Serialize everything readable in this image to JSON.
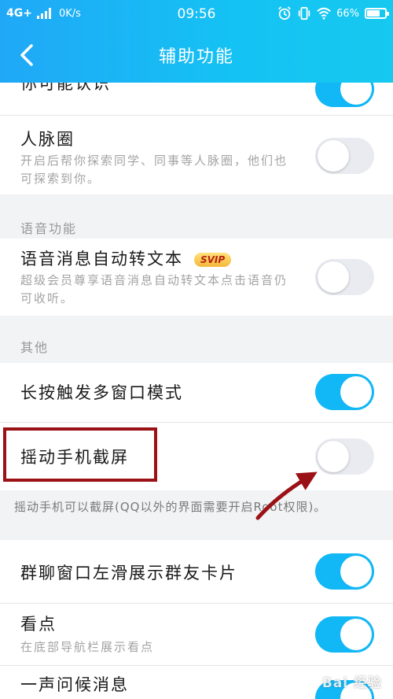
{
  "status_bar": {
    "network": "4G+",
    "speed": "0K/s",
    "time": "09:56",
    "battery": "66%"
  },
  "header": {
    "title": "辅助功能",
    "back_icon": "chevron-left-icon"
  },
  "colors": {
    "header_gradient_start": "#20a8f7",
    "header_gradient_end": "#16c9f0",
    "toggle_on": "#12b7f5",
    "toggle_off": "#e9ebf0",
    "highlight_box": "#9a1116",
    "arrow": "#9a1116"
  },
  "rows": {
    "may_know": {
      "title": "你可能认识",
      "enabled": true
    },
    "contacts_circle": {
      "title": "人脉圈",
      "desc": "开启后帮你探索同学、同事等人脉圈，他们也可探索到你。",
      "enabled": false
    },
    "voice_to_text": {
      "title": "语音消息自动转文本",
      "badge": "SVIP",
      "desc": "超级会员尊享语音消息自动转文本点击语音仍可收听。",
      "enabled": false
    },
    "multi_window": {
      "title": "长按触发多窗口模式",
      "enabled": true
    },
    "shake_screenshot": {
      "title": "摇动手机截屏",
      "enabled": false
    },
    "group_slide": {
      "title": "群聊窗口左滑展示群友卡片",
      "enabled": true
    },
    "kandian": {
      "title": "看点",
      "desc": "在底部导航栏展示看点",
      "enabled": true
    },
    "greeting": {
      "title": "一声问候消息",
      "enabled": true
    }
  },
  "sections": {
    "voice": "语音功能",
    "other": "其他"
  },
  "notes": {
    "shake": "摇动手机可以截屏(QQ以外的界面需要开启Root权限)。"
  },
  "watermark": "Bai 经验"
}
